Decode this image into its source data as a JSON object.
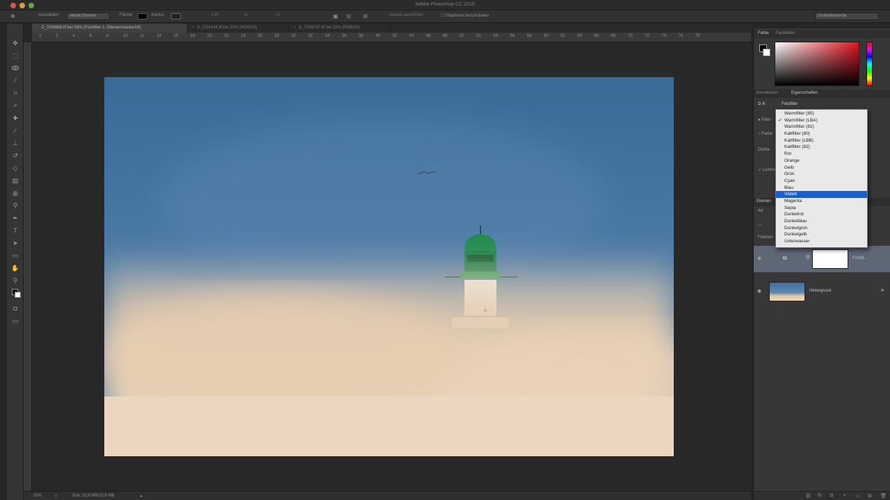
{
  "app": {
    "title": "Adobe Photoshop CC 2015"
  },
  "options_bar": {
    "auto_select_label": "Auswählen:",
    "auto_select_value": "Aktive Ebenen",
    "fill_label": "Fläche:",
    "stroke_label": "Kontur:",
    "stroke_width": "3 Pt",
    "w_label": "B:",
    "h_label": "H:",
    "align_edges": "Kanten ausrichten",
    "constrain": "Pfadlinien beschränken",
    "workspace": "Grundelemente"
  },
  "tabs": [
    {
      "label": "D_DS4968.tif bei 33% (Fotofilter 1, Ebenenmaske/16)",
      "active": true
    },
    {
      "label": "D_DS4244.tif bei 33% (RGB/16)",
      "active": false
    },
    {
      "label": "D_7056747.tif bei 33% (RGB/16)",
      "active": false
    }
  ],
  "ruler_ticks": [
    "0",
    "2",
    "4",
    "6",
    "8",
    "10",
    "12",
    "14",
    "16",
    "18",
    "20",
    "22",
    "24",
    "26",
    "28",
    "30",
    "32",
    "34",
    "36",
    "38",
    "40",
    "42",
    "44",
    "46",
    "48",
    "50",
    "52",
    "54",
    "56",
    "58",
    "60",
    "62",
    "64",
    "66",
    "68",
    "70",
    "72",
    "74",
    "76",
    "78"
  ],
  "status_bar": {
    "zoom": "33%",
    "doc_info": "Dok: 23,8 MB/23,8 MB"
  },
  "panel": {
    "color_tabs": [
      "Farbe",
      "Farbfelder"
    ],
    "prop_tabs": [
      "Korrekturen",
      "Eigenschaften"
    ],
    "prop_title": "Fotofilter",
    "filter_label": "Filter",
    "color_label": "Farbe",
    "density_label": "Dichte",
    "luminance_label": "Luminanz erhalten",
    "layers_label": "Ebenen",
    "kind_label": "Art",
    "opacity_label": "Fixieren:",
    "layers": [
      {
        "name": "Fotofil...",
        "selected": true
      },
      {
        "name": "Hintergrund",
        "selected": false
      }
    ]
  },
  "dropdown": {
    "items": [
      {
        "label": "Warmfilter (85)",
        "checked": false,
        "highlighted": false
      },
      {
        "label": "Warmfilter (LBA)",
        "checked": true,
        "highlighted": false
      },
      {
        "label": "Warmfilter (81)",
        "checked": false,
        "highlighted": false
      },
      {
        "label": "Kaltfilter (80)",
        "checked": false,
        "highlighted": false
      },
      {
        "label": "Kaltfilter (LBB)",
        "checked": false,
        "highlighted": false
      },
      {
        "label": "Kaltfilter (82)",
        "checked": false,
        "highlighted": false
      },
      {
        "label": "Rot",
        "checked": false,
        "highlighted": false
      },
      {
        "label": "Orange",
        "checked": false,
        "highlighted": false
      },
      {
        "label": "Gelb",
        "checked": false,
        "highlighted": false
      },
      {
        "label": "Grün",
        "checked": false,
        "highlighted": false
      },
      {
        "label": "Cyan",
        "checked": false,
        "highlighted": false
      },
      {
        "label": "Blau",
        "checked": false,
        "highlighted": false
      },
      {
        "label": "Violett",
        "checked": false,
        "highlighted": true
      },
      {
        "label": "Magenta",
        "checked": false,
        "highlighted": false
      },
      {
        "label": "Sepia",
        "checked": false,
        "highlighted": false
      },
      {
        "label": "Dunkelrot",
        "checked": false,
        "highlighted": false
      },
      {
        "label": "Dunkelblau",
        "checked": false,
        "highlighted": false
      },
      {
        "label": "Dunkelgrün",
        "checked": false,
        "highlighted": false
      },
      {
        "label": "Dunkelgelb",
        "checked": false,
        "highlighted": false
      },
      {
        "label": "Unterwasser",
        "checked": false,
        "highlighted": false
      }
    ]
  },
  "colors": {
    "highlight": "#1a5fd1",
    "sky": "#3d6f9c",
    "fog": "#e6ccad",
    "lighthouse_green": "#1c8c4e"
  }
}
